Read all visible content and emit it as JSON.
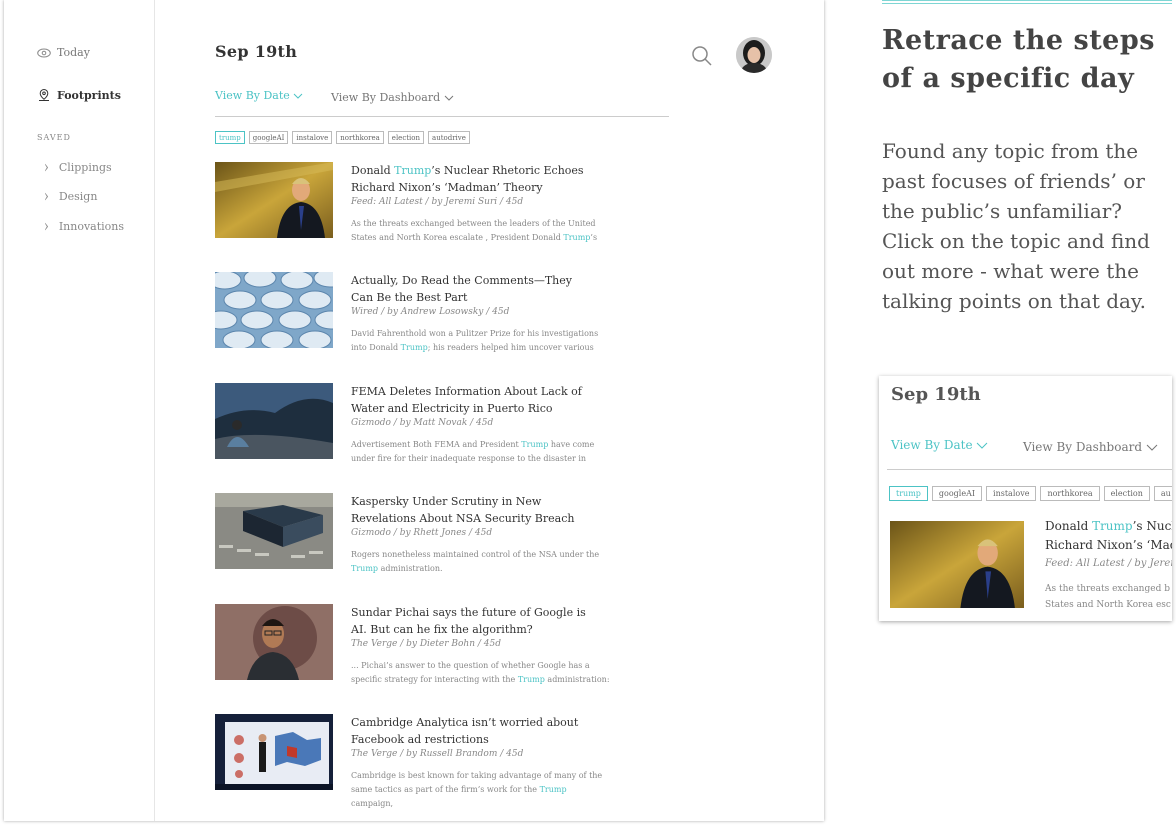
{
  "sidebar": {
    "today": "Today",
    "footprints": "Footprints",
    "saved_label": "SAVED",
    "saved_items": [
      "Clippings",
      "Design",
      "Innovations"
    ]
  },
  "header": {
    "date": "Sep 19th",
    "view_by_date": "View By Date",
    "view_by_dashboard": "View By Dashboard"
  },
  "tags": [
    "trump",
    "googleAI",
    "instalove",
    "northkorea",
    "election",
    "autodrive"
  ],
  "articles": [
    {
      "title_pre": "Donald ",
      "title_hl": "Trump",
      "title_post": "’s Nuclear Rhetoric Echoes Richard Nixon’s ‘Madman’ Theory",
      "meta": "Feed: All Latest / by Jeremi Suri / 45d",
      "ex_pre": "As the threats exchanged between the leaders of the United States and North Korea escalate , President Donald ",
      "ex_hl": "Trump",
      "ex_post": "’s"
    },
    {
      "title_pre": "Actually, Do Read the Comments—They Can Be the Best Part",
      "title_hl": "",
      "title_post": "",
      "meta": "Wired / by Andrew Losowsky / 45d",
      "ex_pre": "David Fahrenthold won a Pulitzer Prize for his investigations into Donald ",
      "ex_hl": "Trump",
      "ex_post": "; his readers helped him uncover various"
    },
    {
      "title_pre": "FEMA Deletes Information About Lack of Water and Electricity in Puerto Rico",
      "title_hl": "",
      "title_post": "",
      "meta": "Gizmodo / by Matt Novak / 45d",
      "ex_pre": "Advertisement Both FEMA and President ",
      "ex_hl": "Trump",
      "ex_post": " have come under fire for their inadequate response to the disaster in"
    },
    {
      "title_pre": "Kaspersky Under Scrutiny in New Revelations About NSA Security Breach",
      "title_hl": "",
      "title_post": "",
      "meta": "Gizmodo / by Rhett Jones / 45d",
      "ex_pre": "Rogers nonetheless maintained control of the NSA under the ",
      "ex_hl": "Trump",
      "ex_post": " administration."
    },
    {
      "title_pre": "Sundar Pichai says the future of Google is AI. But can he fix the algorithm?",
      "title_hl": "",
      "title_post": "",
      "meta": "The Verge / by Dieter Bohn / 45d",
      "ex_pre": "... Pichai’s answer to the question of whether Google has a specific strategy for interacting with the ",
      "ex_hl": "Trump",
      "ex_post": " administration:"
    },
    {
      "title_pre": "Cambridge Analytica isn’t worried about Facebook ad restrictions",
      "title_hl": "",
      "title_post": "",
      "meta": "The Verge / by Russell Brandom / 45d",
      "ex_pre": "Cambridge is best known for taking advantage of many of the same tactics as part of the firm’s work for the ",
      "ex_hl": "Trump",
      "ex_post": " campaign,"
    }
  ],
  "promo": {
    "heading": "Retrace the steps of a specific day",
    "body": "Found any topic from the past focuses of friends’ or the public’s unfamiliar? Click on the topic and find out more - what were the talking points on that day."
  },
  "preview": {
    "date": "Sep 19th",
    "view_by_date": "View By Date",
    "view_by_dashboard": "View By Dashboard",
    "tags": [
      "trump",
      "googleAI",
      "instalove",
      "northkorea",
      "election",
      "au"
    ],
    "title_l1_pre": "Donald ",
    "title_l1_hl": "Trump",
    "title_l1_post": "’s Nucl",
    "title_l2": "Richard Nixon’s ‘Mad",
    "meta": "Feed: All Latest / by Jeren",
    "ex_l1": "As the threats exchanged b",
    "ex_l2": "States and North Korea esc"
  },
  "colors": {
    "accent": "#4cc3c5",
    "text": "#444444"
  }
}
